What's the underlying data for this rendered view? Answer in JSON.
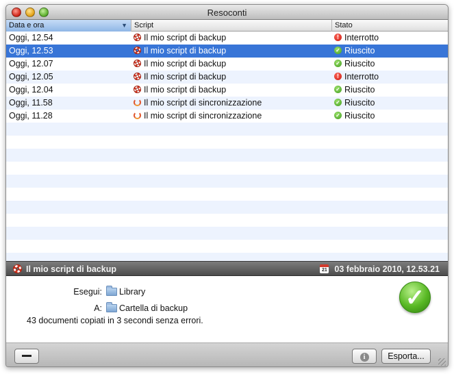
{
  "window": {
    "title": "Resoconti"
  },
  "table": {
    "columns": [
      "Data e ora",
      "Script",
      "Stato"
    ],
    "sorted_column": "Data e ora",
    "rows": [
      {
        "date": "Oggi, 12.54",
        "script": "Il mio script di backup",
        "script_icon": "lifebuoy-icon",
        "status": "Interrotto",
        "status_icon": "error-icon",
        "selected": false
      },
      {
        "date": "Oggi, 12.53",
        "script": "Il mio script di backup",
        "script_icon": "lifebuoy-icon",
        "status": "Riuscito",
        "status_icon": "success-icon",
        "selected": true
      },
      {
        "date": "Oggi, 12.07",
        "script": "Il mio script di backup",
        "script_icon": "lifebuoy-icon",
        "status": "Riuscito",
        "status_icon": "success-icon",
        "selected": false
      },
      {
        "date": "Oggi, 12.05",
        "script": "Il mio script di backup",
        "script_icon": "lifebuoy-icon",
        "status": "Interrotto",
        "status_icon": "error-icon",
        "selected": false
      },
      {
        "date": "Oggi, 12.04",
        "script": "Il mio script di backup",
        "script_icon": "lifebuoy-icon",
        "status": "Riuscito",
        "status_icon": "success-icon",
        "selected": false
      },
      {
        "date": "Oggi, 11.58",
        "script": "Il mio script di sincronizzazione",
        "script_icon": "sync-icon",
        "status": "Riuscito",
        "status_icon": "success-icon",
        "selected": false
      },
      {
        "date": "Oggi, 11.28",
        "script": "Il mio script di sincronizzazione",
        "script_icon": "sync-icon",
        "status": "Riuscito",
        "status_icon": "success-icon",
        "selected": false
      }
    ]
  },
  "detail": {
    "title": "Il mio script di backup",
    "date": "03 febbraio 2010, 12.53.21",
    "calendar_day": "21",
    "source_label": "Esegui:",
    "source_value": "Library",
    "target_label": "A:",
    "target_value": "Cartella di backup",
    "summary": "43 documenti copiati in 3 secondi senza errori."
  },
  "toolbar": {
    "remove_label": "",
    "info_glyph": "i",
    "export_label": "Esporta..."
  },
  "colors": {
    "selection": "#3875d7",
    "error": "#c8120a",
    "success": "#3f9a1e"
  }
}
